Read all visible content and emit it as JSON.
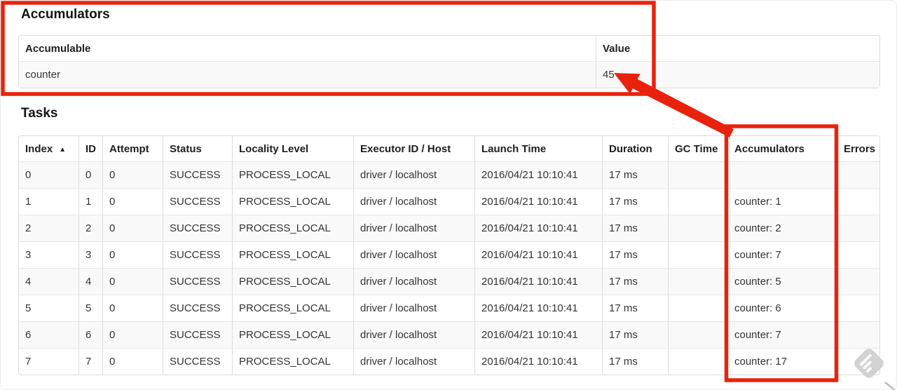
{
  "colors": {
    "annotation_red": "#e8220c",
    "stripe_row": "#f9f9f9",
    "table_border": "#dddddd",
    "watermark_gray": "#d2d2d2"
  },
  "accumulators_section": {
    "title": "Accumulators",
    "table": {
      "headers": [
        "Accumulable",
        "Value"
      ],
      "rows": [
        [
          "counter",
          "45"
        ]
      ]
    }
  },
  "tasks_section": {
    "title": "Tasks",
    "table": {
      "headers": [
        {
          "label": "Index",
          "sort_indicator": "▲"
        },
        {
          "label": "ID"
        },
        {
          "label": "Attempt"
        },
        {
          "label": "Status"
        },
        {
          "label": "Locality Level"
        },
        {
          "label": "Executor ID / Host"
        },
        {
          "label": "Launch Time"
        },
        {
          "label": "Duration"
        },
        {
          "label": "GC Time"
        },
        {
          "label": "Accumulators"
        },
        {
          "label": "Errors"
        }
      ],
      "rows": [
        [
          "0",
          "0",
          "0",
          "SUCCESS",
          "PROCESS_LOCAL",
          "driver / localhost",
          "2016/04/21 10:10:41",
          "17 ms",
          "",
          "",
          ""
        ],
        [
          "1",
          "1",
          "0",
          "SUCCESS",
          "PROCESS_LOCAL",
          "driver / localhost",
          "2016/04/21 10:10:41",
          "17 ms",
          "",
          "counter: 1",
          ""
        ],
        [
          "2",
          "2",
          "0",
          "SUCCESS",
          "PROCESS_LOCAL",
          "driver / localhost",
          "2016/04/21 10:10:41",
          "17 ms",
          "",
          "counter: 2",
          ""
        ],
        [
          "3",
          "3",
          "0",
          "SUCCESS",
          "PROCESS_LOCAL",
          "driver / localhost",
          "2016/04/21 10:10:41",
          "17 ms",
          "",
          "counter: 7",
          ""
        ],
        [
          "4",
          "4",
          "0",
          "SUCCESS",
          "PROCESS_LOCAL",
          "driver / localhost",
          "2016/04/21 10:10:41",
          "17 ms",
          "",
          "counter: 5",
          ""
        ],
        [
          "5",
          "5",
          "0",
          "SUCCESS",
          "PROCESS_LOCAL",
          "driver / localhost",
          "2016/04/21 10:10:41",
          "17 ms",
          "",
          "counter: 6",
          ""
        ],
        [
          "6",
          "6",
          "0",
          "SUCCESS",
          "PROCESS_LOCAL",
          "driver / localhost",
          "2016/04/21 10:10:41",
          "17 ms",
          "",
          "counter: 7",
          ""
        ],
        [
          "7",
          "7",
          "0",
          "SUCCESS",
          "PROCESS_LOCAL",
          "driver / localhost",
          "2016/04/21 10:10:41",
          "17 ms",
          "",
          "counter: 17",
          ""
        ]
      ]
    }
  }
}
